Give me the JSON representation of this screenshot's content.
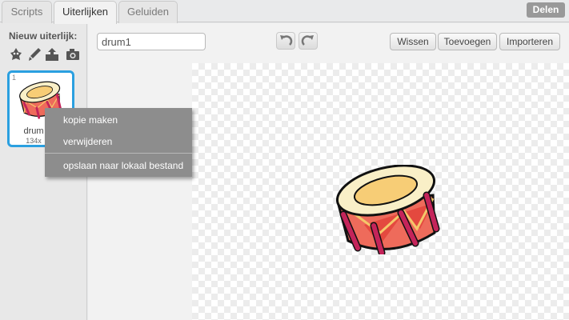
{
  "tabs": [
    {
      "label": "Scripts"
    },
    {
      "label": "Uiterlijken"
    },
    {
      "label": "Geluiden"
    }
  ],
  "share_button": {
    "label": "Delen"
  },
  "sidebar": {
    "title": "Nieuw uiterlijk:",
    "tools": [
      {
        "icon": "sprite-library-icon"
      },
      {
        "icon": "paint-brush-icon"
      },
      {
        "icon": "upload-icon"
      },
      {
        "icon": "camera-icon"
      }
    ]
  },
  "costume": {
    "number": "1",
    "name": "drum",
    "size": "134x"
  },
  "editor": {
    "costume_name": "drum1",
    "buttons": {
      "clear": "Wissen",
      "add": "Toevoegen",
      "import": "Importeren"
    }
  },
  "context_menu": {
    "items": [
      {
        "label": "kopie maken"
      },
      {
        "label": "verwijderen"
      },
      {
        "label": "opslaan naar lokaal bestand"
      }
    ]
  },
  "colors": {
    "accent": "#2ba0e0",
    "menu_bg": "#8d8d8d",
    "share_bg": "#999999"
  }
}
